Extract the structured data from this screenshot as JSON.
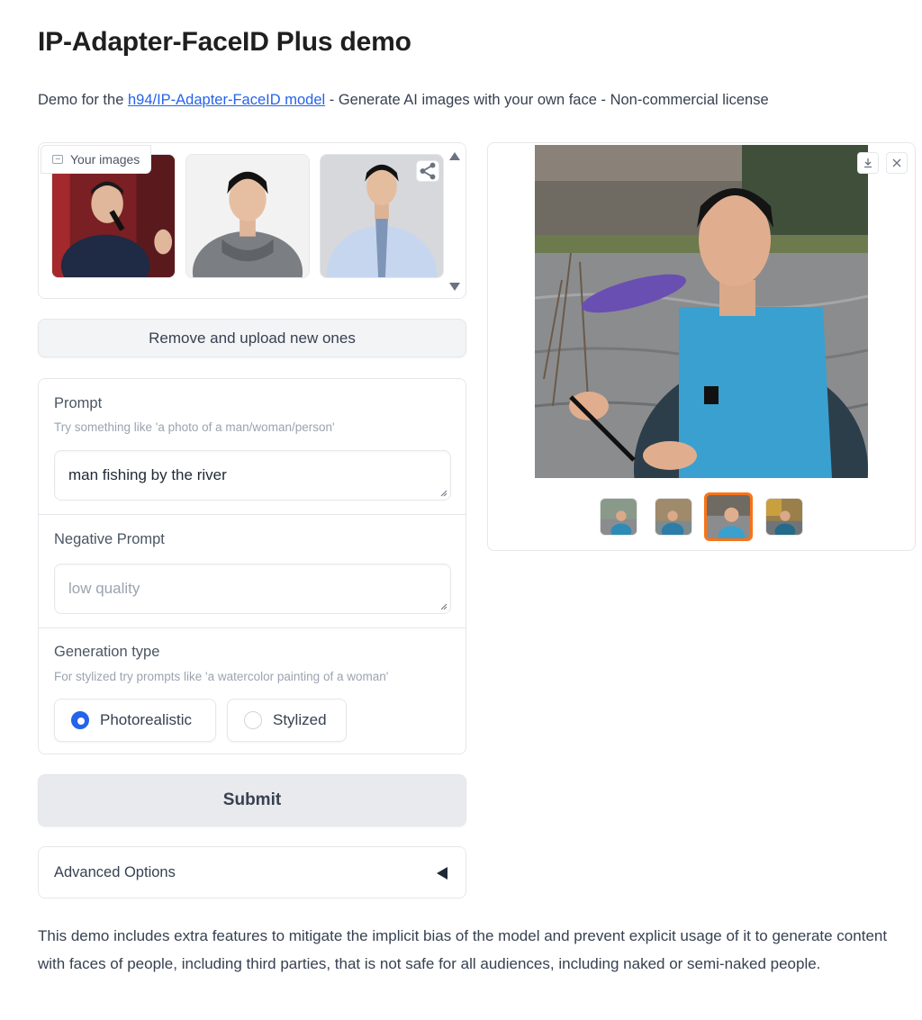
{
  "header": {
    "title": "IP-Adapter-FaceID Plus demo",
    "subtitle_prefix": "Demo for the ",
    "model_link": "h94/IP-Adapter-FaceID model",
    "subtitle_suffix": " - Generate AI images with your own face - Non-commercial license"
  },
  "gallery": {
    "label": "Your images",
    "label_icon": "image-icon",
    "share_icon": "share-icon",
    "scroll_up_icon": "caret-up-icon",
    "scroll_down_icon": "caret-down-icon"
  },
  "remove_button": {
    "label": "Remove and upload new ones"
  },
  "prompt": {
    "label": "Prompt",
    "info": "Try something like 'a photo of a man/woman/person'",
    "value": "man fishing by the river"
  },
  "negative_prompt": {
    "label": "Negative Prompt",
    "placeholder": "low quality"
  },
  "generation_type": {
    "label": "Generation type",
    "info": "For stylized try prompts like 'a watercolor painting of a woman'",
    "options": [
      "Photorealistic",
      "Stylized"
    ],
    "selected": "Photorealistic"
  },
  "submit_button": {
    "label": "Submit"
  },
  "advanced": {
    "label": "Advanced Options",
    "icon": "caret-left-icon"
  },
  "disclaimer": "This demo includes extra features to mitigate the implicit bias of the model and prevent explicit usage of it to generate content with faces of people, including third parties, that is not safe for all audiences, including naked or semi-naked people.",
  "output": {
    "download_icon": "download-icon",
    "close_icon": "close-icon",
    "selected_thumbnail": 3,
    "thumbnail_count": 4
  },
  "colors": {
    "accent": "#2563eb",
    "selected_border": "#f97316"
  }
}
